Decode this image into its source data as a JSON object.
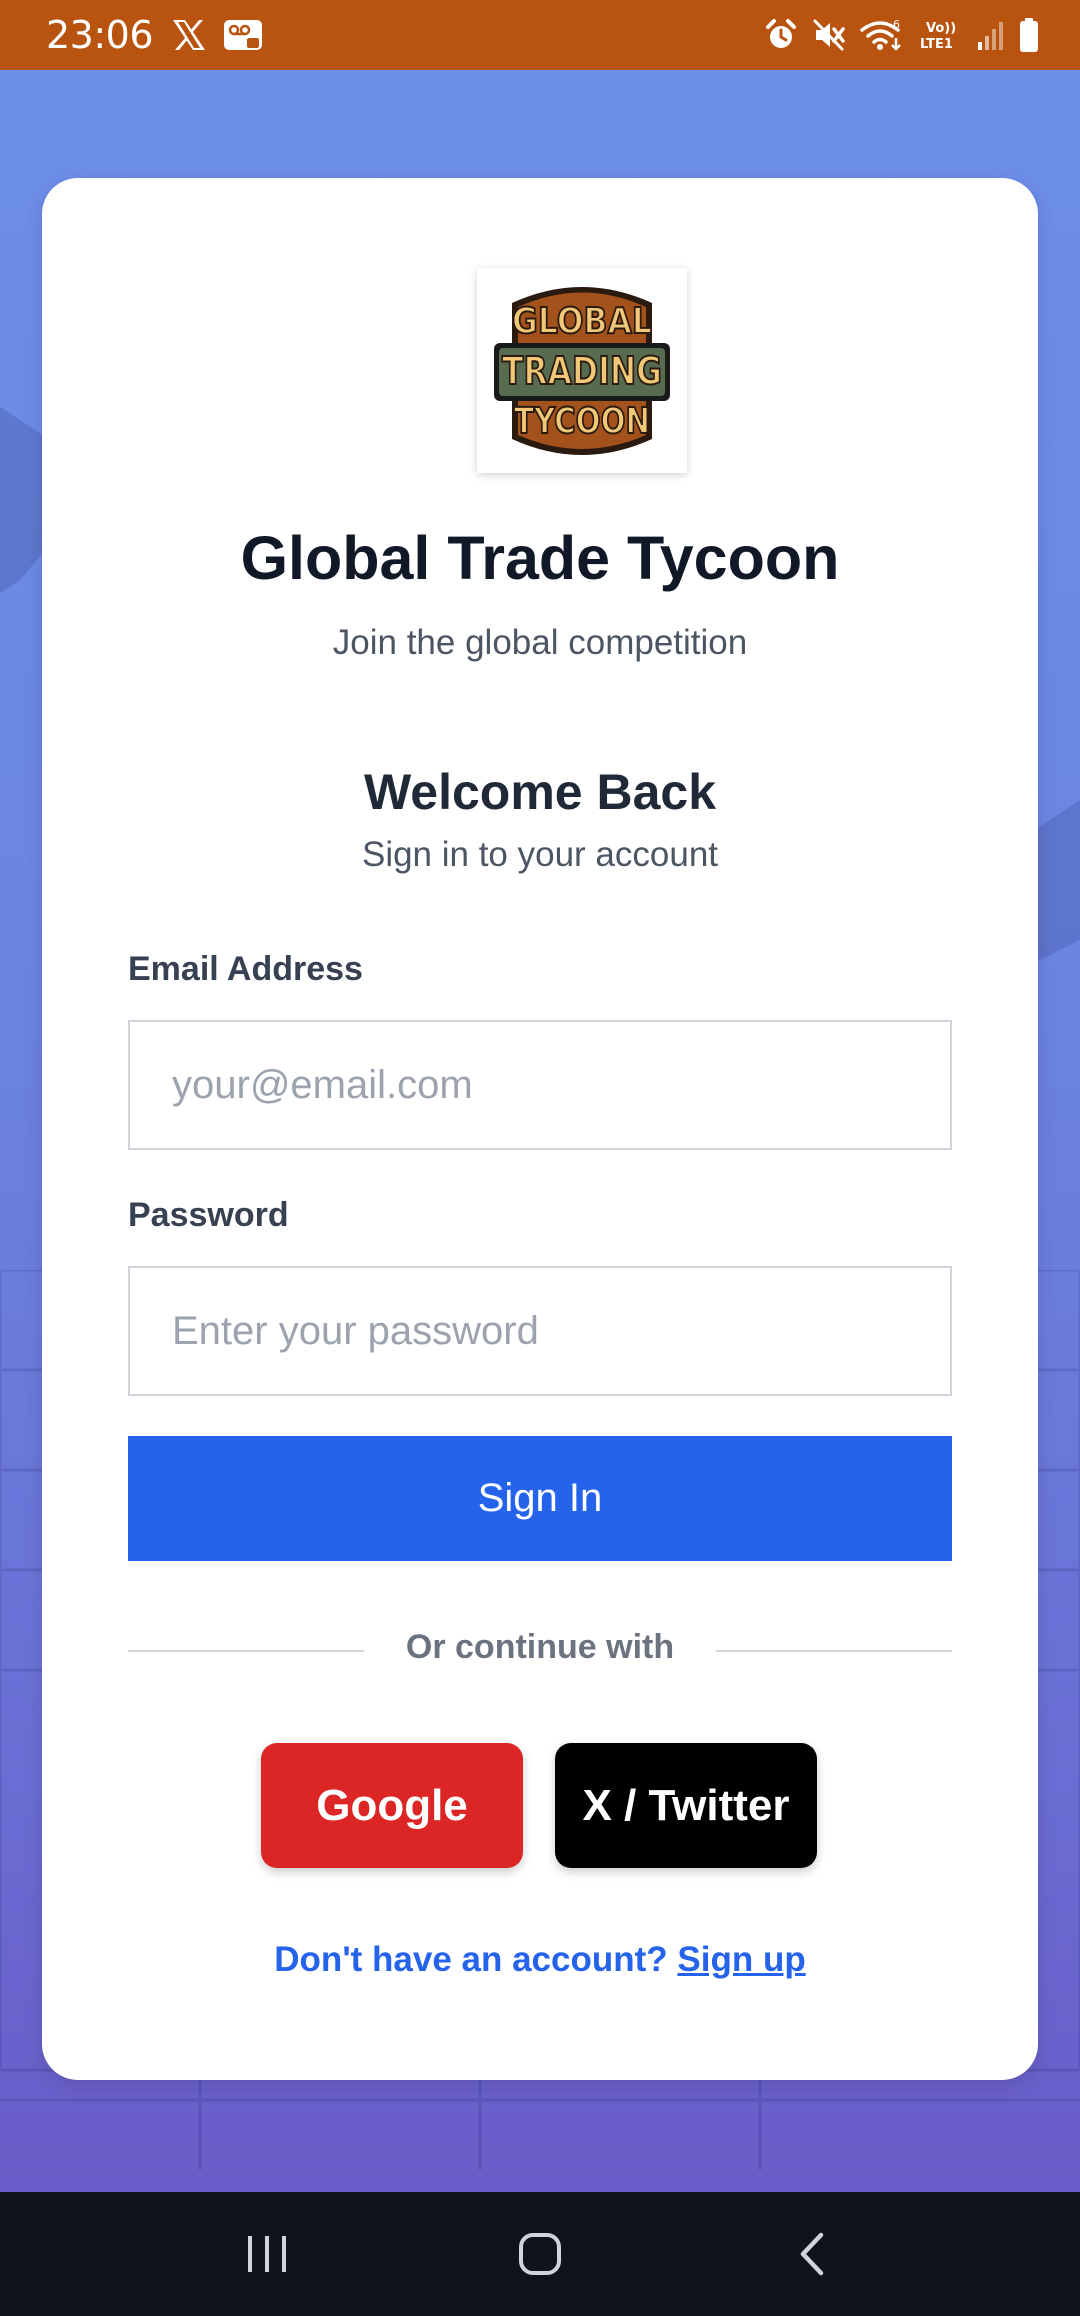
{
  "status_bar": {
    "time": "23:06",
    "left_icons": [
      "x-logo-icon",
      "voicemail-icon"
    ],
    "right_icons": [
      "alarm-icon",
      "mute-icon",
      "wifi-icon",
      "volte-icon",
      "signal-icon",
      "battery-icon"
    ],
    "network_label_top": "Vo))",
    "network_label_bottom": "LTE1",
    "wifi_label": "6"
  },
  "logo": {
    "line1": "GLOBAL",
    "line2": "TRADING",
    "line3": "TYCOON"
  },
  "header": {
    "title": "Global Trade Tycoon",
    "subtitle": "Join the global competition"
  },
  "form": {
    "heading": "Welcome Back",
    "subheading": "Sign in to your account",
    "email_label": "Email Address",
    "email_placeholder": "your@email.com",
    "email_value": "",
    "password_label": "Password",
    "password_placeholder": "Enter your password",
    "password_value": "",
    "submit_label": "Sign In"
  },
  "social": {
    "divider_text": "Or continue with",
    "google_label": "Google",
    "twitter_label": "X / Twitter"
  },
  "signup": {
    "prompt": "Don't have an account?",
    "link_label": "Sign up"
  },
  "nav_bar": {
    "buttons": [
      "recent-apps-icon",
      "home-icon",
      "back-icon"
    ]
  },
  "colors": {
    "status_bar": "#b8540f",
    "primary": "#2563eb",
    "google": "#dc2626",
    "twitter": "#000000",
    "nav_bar": "#0f141b"
  }
}
